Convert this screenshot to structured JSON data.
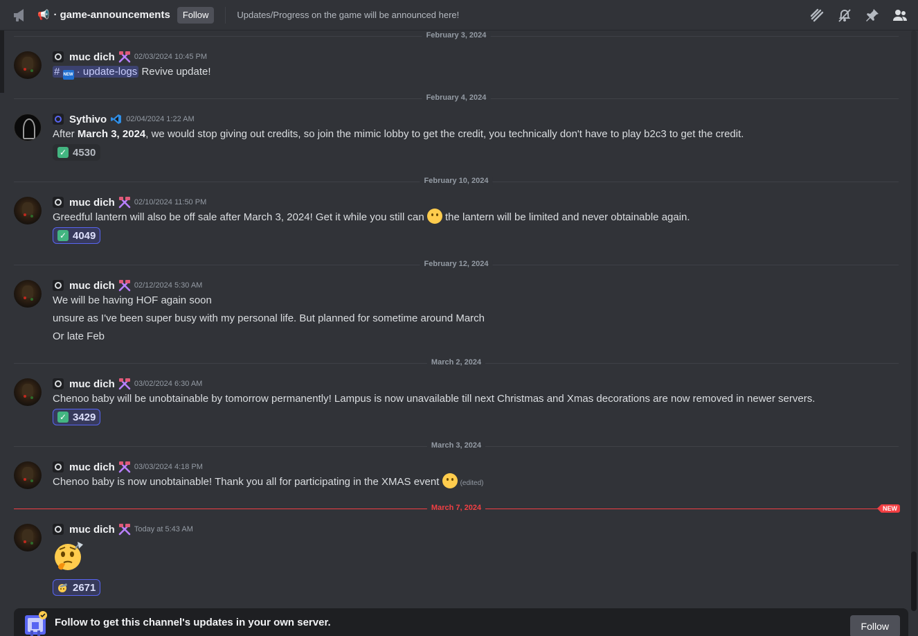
{
  "header": {
    "channel_emoji": "📢",
    "channel_name": "game-announcements",
    "follow_label": "Follow",
    "topic": "Updates/Progress on the game will be announced here!",
    "icons": [
      "threads-icon",
      "notification-muted-icon",
      "pin-icon",
      "member-list-icon"
    ]
  },
  "dividers": [
    {
      "label": "February 3, 2024"
    },
    {
      "label": "February 4, 2024"
    },
    {
      "label": "February 10, 2024"
    },
    {
      "label": "February 12, 2024"
    },
    {
      "label": "March 2, 2024"
    },
    {
      "label": "March 3, 2024"
    },
    {
      "label": "March 7, 2024",
      "badge": "NEW"
    }
  ],
  "messages": [
    {
      "author": "muc dich",
      "timestamp": "02/03/2024 10:45 PM",
      "mention_channel": "update-logs",
      "text": "Revive update!"
    },
    {
      "author": "Sythivo",
      "timestamp": "02/04/2024 1:22 AM",
      "text_pre": "After ",
      "text_bold": "March 3, 2024",
      "text_post": ", we would stop giving out credits, so join the mimic lobby to get the credit, you technically don't have to play b2c3 to get the credit.",
      "reaction_count": "4530"
    },
    {
      "author": "muc dich",
      "timestamp": "02/10/2024 11:50 PM",
      "text_pre": "Greedful lantern will also be off sale after March 3, 2024! Get it while you still can ",
      "text_post": " the lantern will be limited and never obtainable again.",
      "reaction_count": "4049"
    },
    {
      "author": "muc dich",
      "timestamp": "02/12/2024 5:30 AM",
      "lines": [
        "We will be having HOF again soon",
        "unsure as I've been super busy with my personal life. But planned for sometime around March",
        "Or late Feb"
      ]
    },
    {
      "author": "muc dich",
      "timestamp": "03/02/2024 6:30 AM",
      "text": "Chenoo baby will be unobtainable by tomorrow permanently! Lampus is now unavailable till next Christmas and Xmas decorations are now removed in newer servers.",
      "reaction_count": "3429"
    },
    {
      "author": "muc dich",
      "timestamp": "03/03/2024 4:18 PM",
      "text": "Chenoo baby is now unobtainable! Thank you all for participating in the XMAS event ",
      "edited": "(edited)"
    },
    {
      "author": "muc dich",
      "timestamp": "Today at 5:43 AM",
      "big_emoji": "thinking-face-emoji",
      "reaction_count": "2671"
    }
  ],
  "footer": {
    "text": "Follow to get this channel's updates in your own server.",
    "follow_label": "Follow"
  },
  "colors": {
    "background": "#313338",
    "accent": "#5865f2",
    "new_divider": "#f23f43",
    "reaction_check": "#43b581"
  }
}
